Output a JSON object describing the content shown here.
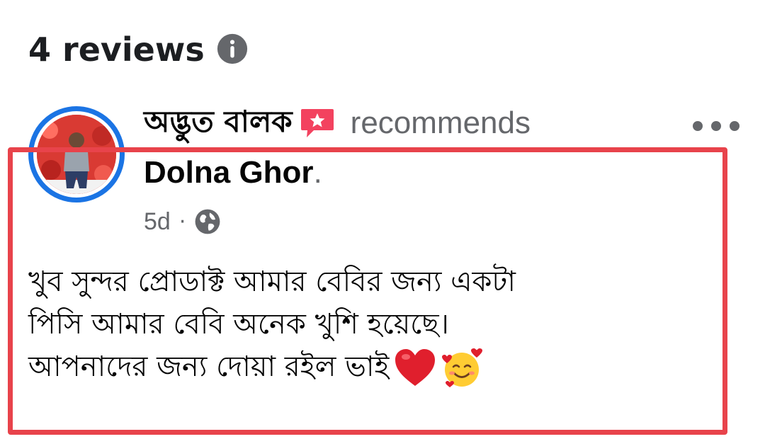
{
  "reviews": {
    "title": "4 reviews",
    "info_icon": "info-circle-icon"
  },
  "review": {
    "author_name": "অদ্ভুত বালক",
    "badge_icon": "recommend-speech-badge-icon",
    "action_text": "recommends",
    "page_name": "Dolna Ghor",
    "page_dot": ".",
    "time": "5d",
    "separator": "·",
    "audience_icon": "globe-icon",
    "more_icon": "more-horizontal-icon",
    "text_lines": [
      "খুব সুন্দর প্রোডাক্ট আমার বেবির জন্য একটা",
      "পিসি আমার বেবি অনেক খুশি হয়েছে।",
      "আপনাদের জন্য দোয়া রইল ভাই"
    ],
    "emojis": [
      "red-heart-icon",
      "smiling-face-with-hearts-icon"
    ]
  },
  "colors": {
    "highlight": "#e8434b",
    "avatar_ring": "#1b74e4",
    "secondary_text": "#65676b",
    "badge": "#f3425f"
  }
}
